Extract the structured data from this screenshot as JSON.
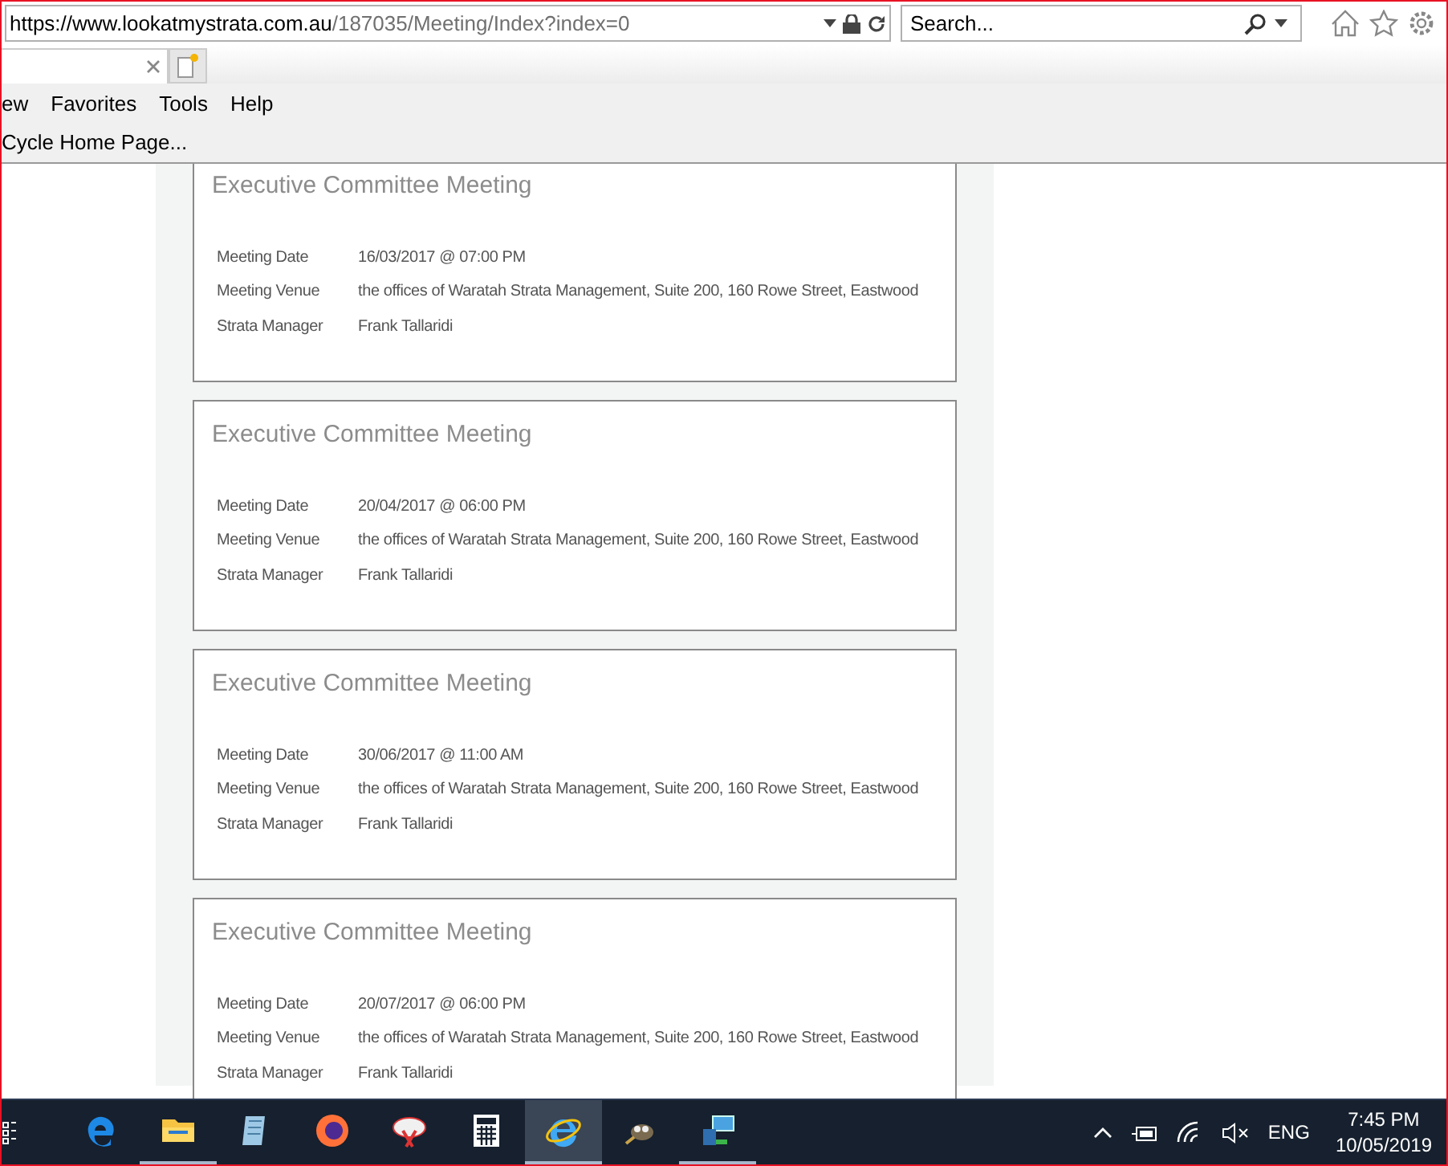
{
  "address_bar": {
    "url_host": "https://www.lookatmystrata.com.au",
    "url_path": "/187035/Meeting/Index?index=0"
  },
  "search": {
    "placeholder": "Search..."
  },
  "menu_bar": [
    "ew",
    "Favorites",
    "Tools",
    "Help"
  ],
  "favorites_bar": [
    "Cycle Home Page..."
  ],
  "meetings": [
    {
      "title": "Executive Committee Meeting",
      "fields": [
        {
          "label": "Meeting Date",
          "value": "16/03/2017 @ 07:00 PM"
        },
        {
          "label": "Meeting Venue",
          "value": "the offices of Waratah Strata Management, Suite 200, 160 Rowe Street, Eastwood"
        },
        {
          "label": "Strata Manager",
          "value": "Frank Tallaridi"
        }
      ]
    },
    {
      "title": "Executive Committee Meeting",
      "fields": [
        {
          "label": "Meeting Date",
          "value": "20/04/2017 @ 06:00 PM"
        },
        {
          "label": "Meeting Venue",
          "value": "the offices of Waratah Strata Management, Suite 200, 160 Rowe Street, Eastwood"
        },
        {
          "label": "Strata Manager",
          "value": "Frank Tallaridi"
        }
      ]
    },
    {
      "title": "Executive Committee Meeting",
      "fields": [
        {
          "label": "Meeting Date",
          "value": "30/06/2017 @ 11:00 AM"
        },
        {
          "label": "Meeting Venue",
          "value": "the offices of Waratah Strata Management, Suite 200, 160 Rowe Street, Eastwood"
        },
        {
          "label": "Strata Manager",
          "value": "Frank Tallaridi"
        }
      ]
    },
    {
      "title": "Executive Committee Meeting",
      "fields": [
        {
          "label": "Meeting Date",
          "value": "20/07/2017 @ 06:00 PM"
        },
        {
          "label": "Meeting Venue",
          "value": "the offices of Waratah Strata Management, Suite 200, 160 Rowe Street, Eastwood"
        },
        {
          "label": "Strata Manager",
          "value": "Frank Tallaridi"
        }
      ]
    }
  ],
  "taskbar": {
    "apps": [
      {
        "kind": "edge",
        "running": false,
        "selected": false
      },
      {
        "kind": "folder",
        "running": true,
        "selected": false
      },
      {
        "kind": "notepad",
        "running": false,
        "selected": false
      },
      {
        "kind": "firefox",
        "running": false,
        "selected": false
      },
      {
        "kind": "snip",
        "running": false,
        "selected": false
      },
      {
        "kind": "calculator",
        "running": false,
        "selected": false
      },
      {
        "kind": "ie",
        "running": true,
        "selected": true
      },
      {
        "kind": "gimp",
        "running": false,
        "selected": false
      },
      {
        "kind": "remote",
        "running": true,
        "selected": false
      }
    ],
    "language": "ENG",
    "time": "7:45 PM",
    "date": "10/05/2019"
  }
}
